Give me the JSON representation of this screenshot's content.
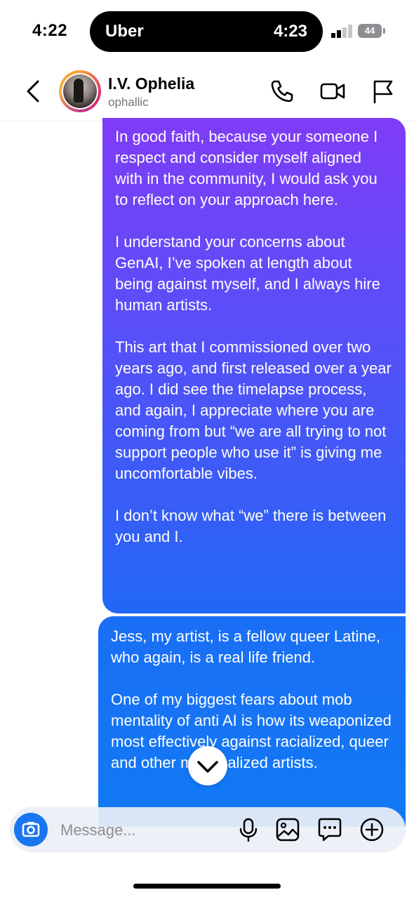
{
  "status_bar": {
    "time": "4:22",
    "live_activity_app": "Uber",
    "live_activity_time": "4:23",
    "battery": "44"
  },
  "header": {
    "name": "I.V. Ophelia",
    "handle": "ophallic"
  },
  "messages": [
    {
      "paragraphs": [
        "In good faith, because your someone I respect and consider myself aligned with in the community, I would ask you to reflect on your approach here.",
        "I understand your concerns about GenAI, I’ve spoken at length about being against myself, and I always hire human artists.",
        "This art that I commissioned over two years ago, and first released over a year ago. I did see the timelapse process, and again, I appreciate where you are coming from but “we are all trying to not support people who use it” is giving me uncomfortable vibes.",
        "I don’t know what “we” there is between you and I."
      ]
    },
    {
      "paragraphs": [
        "Jess, my artist, is a fellow queer Latine, who again, is a real life friend.",
        "One of my biggest fears about mob mentality of anti AI is how its weaponized most effectively against racialized, queer and other marginalized artists."
      ]
    }
  ],
  "composer": {
    "placeholder": "Message..."
  },
  "colors": {
    "accent": "#1a75f0",
    "bubble_top": "#7f3cf6",
    "bubble_bottom": "#117af5"
  },
  "icons": [
    "back-chevron-icon",
    "phone-icon",
    "video-camera-icon",
    "flag-icon",
    "camera-icon",
    "microphone-icon",
    "gallery-icon",
    "sticker-icon",
    "plus-circle-icon",
    "chevron-down-icon"
  ]
}
